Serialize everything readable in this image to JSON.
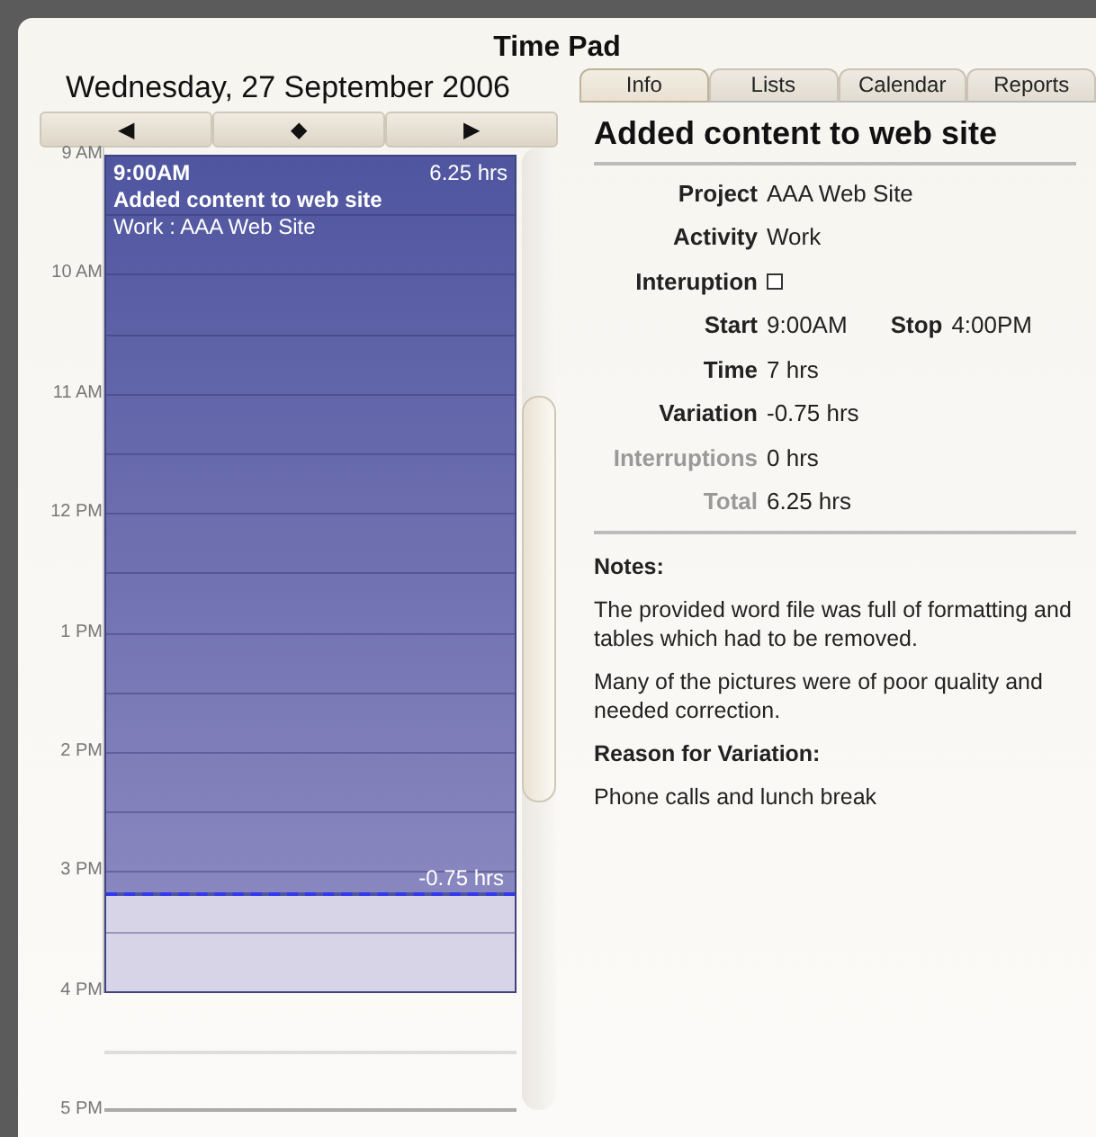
{
  "window": {
    "title": "Time Pad"
  },
  "day": {
    "date": "Wednesday, 27 September 2006",
    "nav": [
      "◀",
      "◆",
      "▶"
    ]
  },
  "timeline": {
    "hours": [
      "9 AM",
      "10 AM",
      "11 AM",
      "12 PM",
      "1 PM",
      "2 PM",
      "3 PM",
      "4 PM",
      "5 PM"
    ],
    "event": {
      "time": "9:00AM",
      "duration": "6.25 hrs",
      "title": "Added content to web site",
      "subtitle": "Work : AAA Web Site",
      "variation": "-0.75 hrs"
    }
  },
  "tabs": [
    {
      "label": "Info",
      "selected": true
    },
    {
      "label": "Lists",
      "selected": false
    },
    {
      "label": "Calendar",
      "selected": false
    },
    {
      "label": "Reports",
      "selected": false
    }
  ],
  "detail": {
    "heading": "Added content to web site",
    "fields": [
      {
        "kind": "text",
        "label": "Project",
        "value": "AAA Web Site",
        "dimmed": false
      },
      {
        "kind": "text",
        "label": "Activity",
        "value": "Work",
        "dimmed": false
      },
      {
        "kind": "checkbox",
        "label": "Interuption",
        "checked": false,
        "dimmed": false
      },
      {
        "kind": "pair",
        "label": "Start",
        "value": "9:00AM",
        "label_2": "Stop",
        "value_2": "4:00PM",
        "dimmed": false
      },
      {
        "kind": "text",
        "label": "Time",
        "value": "7 hrs",
        "dimmed": false
      },
      {
        "kind": "text",
        "label": "Variation",
        "value": "-0.75 hrs",
        "dimmed": false
      },
      {
        "kind": "text",
        "label": "Interruptions",
        "value": "0 hrs",
        "dimmed": true
      },
      {
        "kind": "text",
        "label": "Total",
        "value": "6.25 hrs",
        "dimmed": true
      }
    ],
    "notes_heading": "Notes:",
    "notes": [
      "The provided word file was full of formatting and tables which had to be removed.",
      "Many of the pictures were of poor quality and needed correction."
    ],
    "reason_heading": "Reason for Variation:",
    "reason": "Phone calls and lunch break"
  }
}
